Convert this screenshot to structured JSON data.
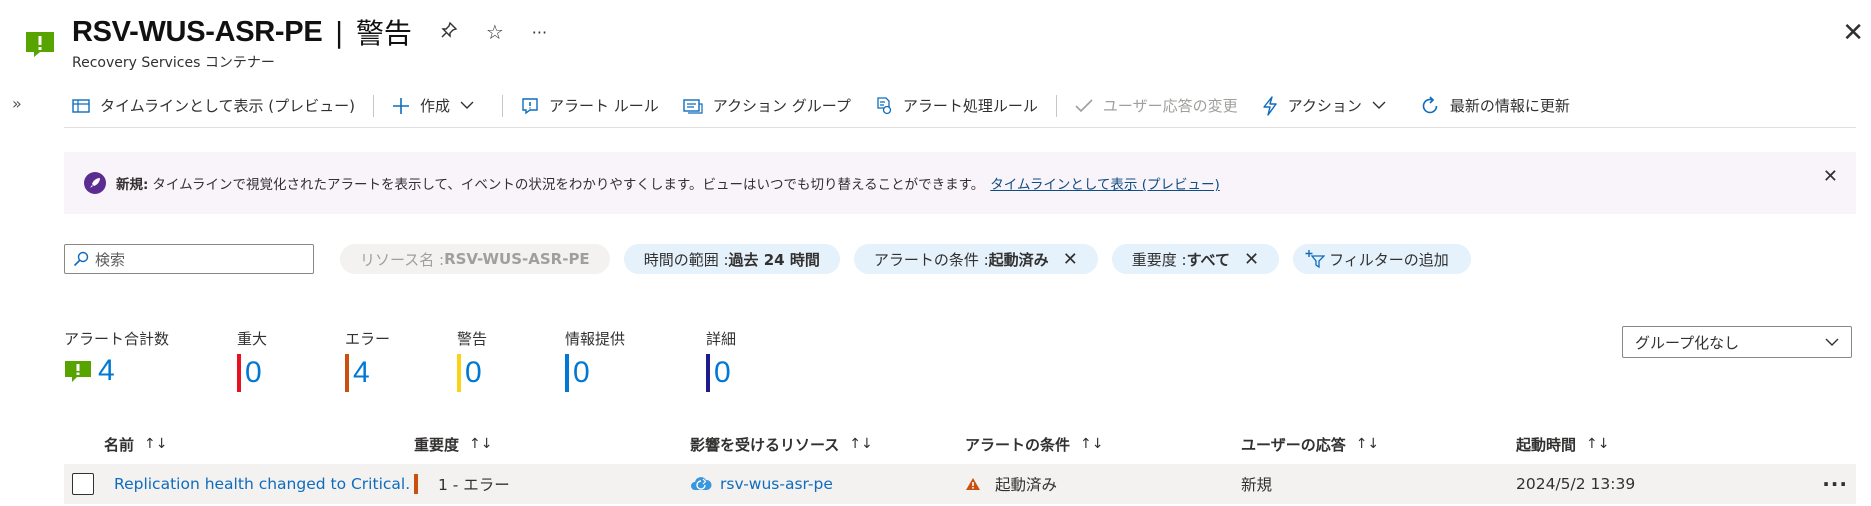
{
  "header": {
    "title": "RSV-WUS-ASR-PE",
    "separator": "|",
    "section": "警告",
    "subtitle": "Recovery Services コンテナー",
    "pin_icon": "pin-icon",
    "star_icon": "star-icon",
    "more_glyph": "···",
    "close_glyph": "✕"
  },
  "toolbar": {
    "timeline": "タイムラインとして表示 (プレビュー)",
    "create": "作成",
    "alert_rules": "アラート ルール",
    "action_groups": "アクション グループ",
    "processing_rules": "アラート処理ルール",
    "change_response": "ユーザー応答の変更",
    "actions": "アクション",
    "refresh": "最新の情報に更新"
  },
  "banner": {
    "bold": "新規:",
    "text": "タイムラインで視覚化されたアラートを表示して、イベントの状況をわかりやすくします。ビューはいつでも切り替えることができます。",
    "link": "タイムラインとして表示 (プレビュー)"
  },
  "filters": {
    "search_placeholder": "検索",
    "resource_label": "リソース名 : ",
    "resource_value": "RSV-WUS-ASR-PE",
    "time_label": "時間の範囲 : ",
    "time_value": "過去 24 時間",
    "condition_label": "アラートの条件 : ",
    "condition_value": "起動済み",
    "severity_label": "重要度 : ",
    "severity_value": "すべて",
    "add_filter": "フィルターの追加"
  },
  "summary": [
    {
      "label": "アラート合計数",
      "value": "4",
      "color": "#57a300"
    },
    {
      "label": "重大",
      "value": "0",
      "color": "#e81123"
    },
    {
      "label": "エラー",
      "value": "4",
      "color": "#ca5010"
    },
    {
      "label": "警告",
      "value": "0",
      "color": "#fcd116"
    },
    {
      "label": "情報提供",
      "value": "0",
      "color": "#0078d4"
    },
    {
      "label": "詳細",
      "value": "0",
      "color": "#1e1b8a"
    }
  ],
  "grouping": {
    "value": "グループ化なし"
  },
  "table": {
    "columns": [
      "名前",
      "重要度",
      "影響を受けるリソース",
      "アラートの条件",
      "ユーザーの応答",
      "起動時間"
    ],
    "sort_glyph": "↑↓",
    "rows": [
      {
        "name": "Replication health changed to Critical.",
        "severity": "1 - エラー",
        "resource": "rsv-wus-asr-pe",
        "condition": "起動済み",
        "response": "新規",
        "time": "2024/5/2 13:39",
        "more": "···"
      }
    ]
  }
}
